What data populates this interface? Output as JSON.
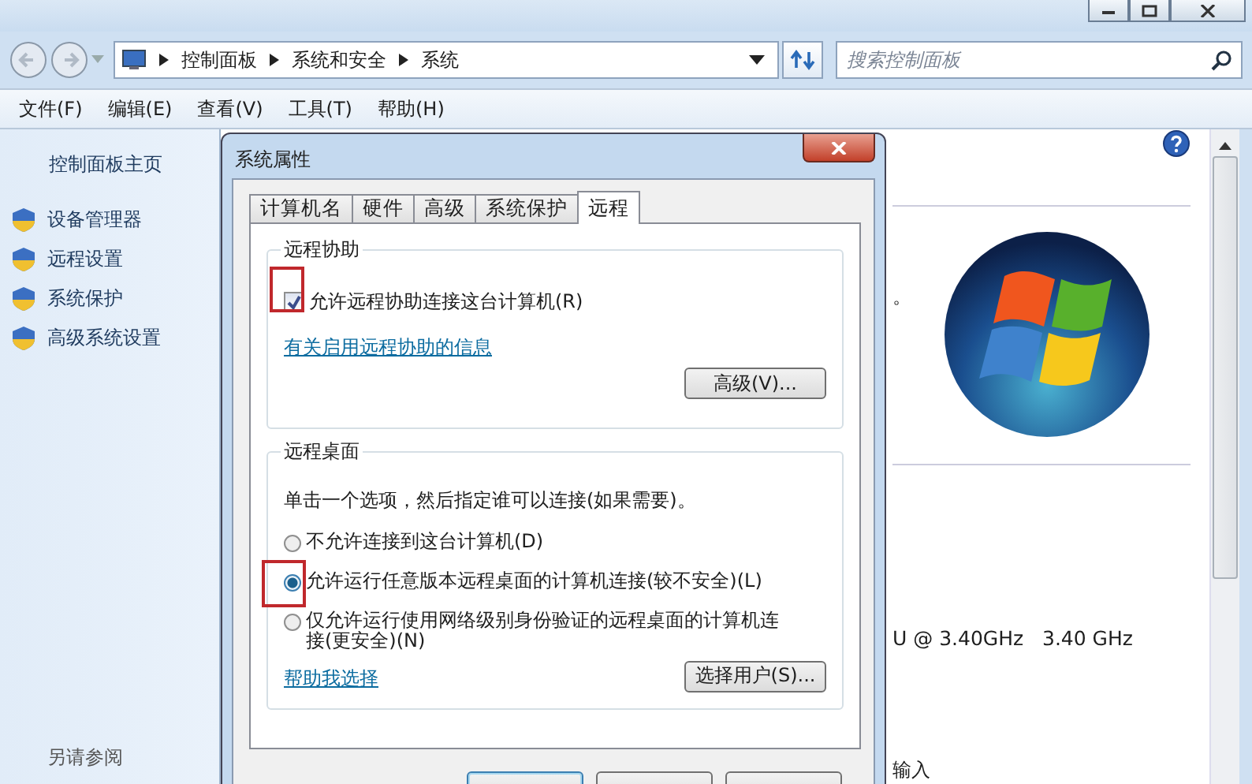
{
  "address_bar": {
    "breadcrumbs": [
      "控制面板",
      "系统和安全",
      "系统"
    ],
    "search": {
      "placeholder": "搜索控制面板"
    }
  },
  "menu_bar": [
    "文件(F)",
    "编辑(E)",
    "查看(V)",
    "工具(T)",
    "帮助(H)"
  ],
  "sidebar": {
    "home": "控制面板主页",
    "items": [
      "设备管理器",
      "远程设置",
      "系统保护",
      "高级系统设置"
    ],
    "see_also": "另请参阅"
  },
  "main": {
    "fragments": [
      "。",
      "U @ 3.40GHz   3.40 GHz",
      "输入"
    ]
  },
  "dialog": {
    "title": "系统属性",
    "tabs": [
      {
        "label": "计算机名",
        "selected": false
      },
      {
        "label": "硬件",
        "selected": false
      },
      {
        "label": "高级",
        "selected": false
      },
      {
        "label": "系统保护",
        "selected": false
      },
      {
        "label": "远程",
        "selected": true
      }
    ],
    "remote_assistance": {
      "title": "远程协助",
      "checkbox": {
        "label": "允许远程协助连接这台计算机(R)",
        "checked": true
      },
      "link": "有关启用远程协助的信息",
      "button": "高级(V)..."
    },
    "remote_desktop": {
      "title": "远程桌面",
      "description": "单击一个选项，然后指定谁可以连接(如果需要)。",
      "options": [
        {
          "label": "不允许连接到这台计算机(D)",
          "selected": false
        },
        {
          "label": "允许运行任意版本远程桌面的计算机连接(较不安全)(L)",
          "selected": true
        },
        {
          "label": "仅允许运行使用网络级别身份验证的远程桌面的计算机连接(更安全)(N)",
          "selected": false
        }
      ],
      "link": "帮助我选择",
      "button": "选择用户(S)..."
    }
  }
}
